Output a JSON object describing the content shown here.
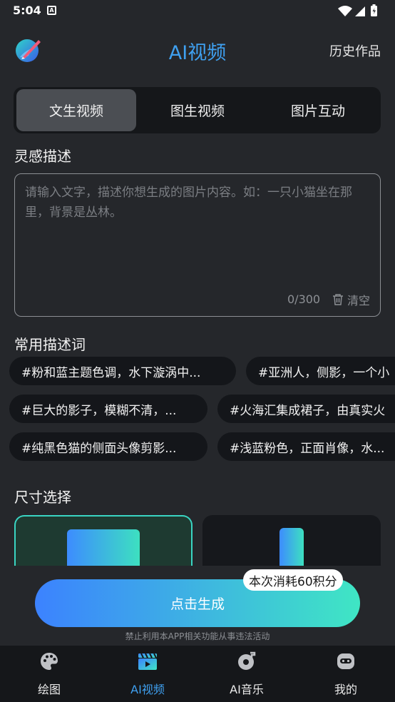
{
  "status_bar": {
    "time": "5:04",
    "notification_letter": "A"
  },
  "header": {
    "title": "AI视频",
    "history_label": "历史作品"
  },
  "tabs": [
    {
      "label": "文生视频",
      "active": true
    },
    {
      "label": "图生视频",
      "active": false
    },
    {
      "label": "图片互动",
      "active": false
    }
  ],
  "inspiration": {
    "title": "灵感描述",
    "placeholder": "请输入文字，描述你想生成的图片内容。如：一只小猫坐在那里，背景是丛林。",
    "char_count": "0/300",
    "clear_label": "清空"
  },
  "keywords": {
    "title": "常用描述词",
    "chips": [
      "#粉和蓝主题色调，水下漩涡中...",
      "#亚洲人，侧影，一个小",
      "#巨大的影子，模糊不清，...",
      "#火海汇集成裙子，由真实火",
      "#纯黑色猫的侧面头像剪影...",
      "#浅蓝粉色，正面肖像，水..."
    ]
  },
  "size": {
    "title": "尺寸选择"
  },
  "generate": {
    "button_label": "点击生成",
    "cost_badge": "本次消耗60积分",
    "disclaimer": "禁止利用本APP相关功能从事违法活动"
  },
  "nav": [
    {
      "label": "绘图",
      "icon": "palette-icon",
      "active": false
    },
    {
      "label": "AI视频",
      "icon": "clapperboard-icon",
      "active": true
    },
    {
      "label": "AI音乐",
      "icon": "music-disc-icon",
      "active": false
    },
    {
      "label": "我的",
      "icon": "robot-face-icon",
      "active": false
    }
  ],
  "colors": {
    "background": "#25272b",
    "accent_blue": "#3fa0f0",
    "gradient_start": "#3c82ff",
    "gradient_end": "#3fe6c4"
  }
}
